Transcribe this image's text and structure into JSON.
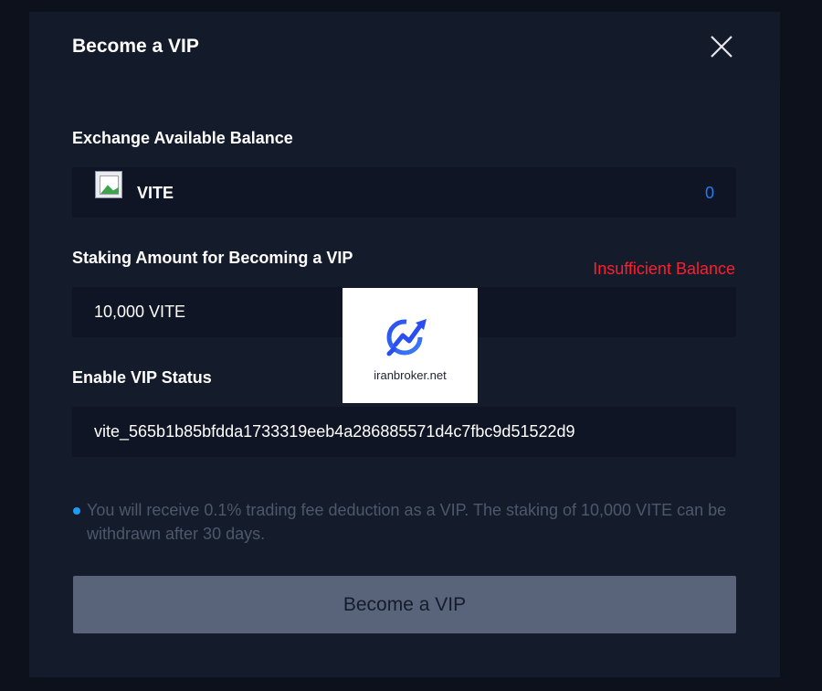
{
  "modal": {
    "title": "Become a VIP"
  },
  "balance_section": {
    "label": "Exchange Available Balance",
    "coin_name": "VITE",
    "coin_balance": "0"
  },
  "staking_section": {
    "label": "Staking Amount for Becoming a VIP",
    "error": "Insufficient Balance",
    "amount": "10,000 VITE"
  },
  "vip_status_section": {
    "label": "Enable VIP Status",
    "address": "vite_565b1b85bfdda1733319eeb4a286885571d4c7fbc9d51522d9"
  },
  "note": "You will receive 0.1% trading fee deduction as a VIP. The staking of 10,000 VITE can be withdrawn after 30 days.",
  "primary_button": "Become a VIP",
  "watermark_text": "iranbroker.net",
  "icons": {
    "close": "close-icon",
    "coin": "broken-image-icon",
    "watermark_logo": "chart-search-logo-icon"
  },
  "colors": {
    "accent_blue": "#1e7cf5",
    "error_red": "#ff1e2d",
    "button_bg": "#59647b",
    "panel_bg": "#141b2b"
  }
}
